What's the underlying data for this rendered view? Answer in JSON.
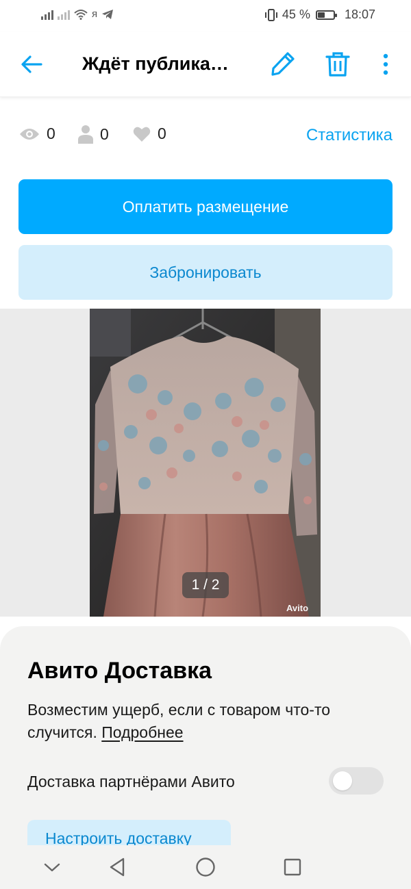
{
  "status_bar": {
    "carrier_glyph": "я",
    "battery_percent": "45 %",
    "battery_level": 0.45,
    "time": "18:07"
  },
  "header": {
    "title": "Ждёт публика…",
    "icons": [
      "back-arrow-icon",
      "pencil-icon",
      "trash-icon",
      "more-vertical-icon"
    ]
  },
  "stats": {
    "views": "0",
    "contacts": "0",
    "favorites": "0",
    "link_label": "Статистика"
  },
  "actions": {
    "pay_label": "Оплатить размещение",
    "reserve_label": "Забронировать"
  },
  "gallery": {
    "counter": "1 / 2",
    "watermark": "Avito"
  },
  "delivery": {
    "title": "Авито Доставка",
    "description": "Возместим ущерб, если с товаром что-то случится.",
    "more_link": "Подробнее",
    "partners_label": "Доставка партнёрами Авито",
    "partners_enabled": false,
    "setup_label": "Настроить доставку"
  },
  "colors": {
    "accent": "#00aaff",
    "accent_text": "#0b88cf",
    "accent_light": "#d4eefc",
    "link": "#0aa3f0"
  }
}
